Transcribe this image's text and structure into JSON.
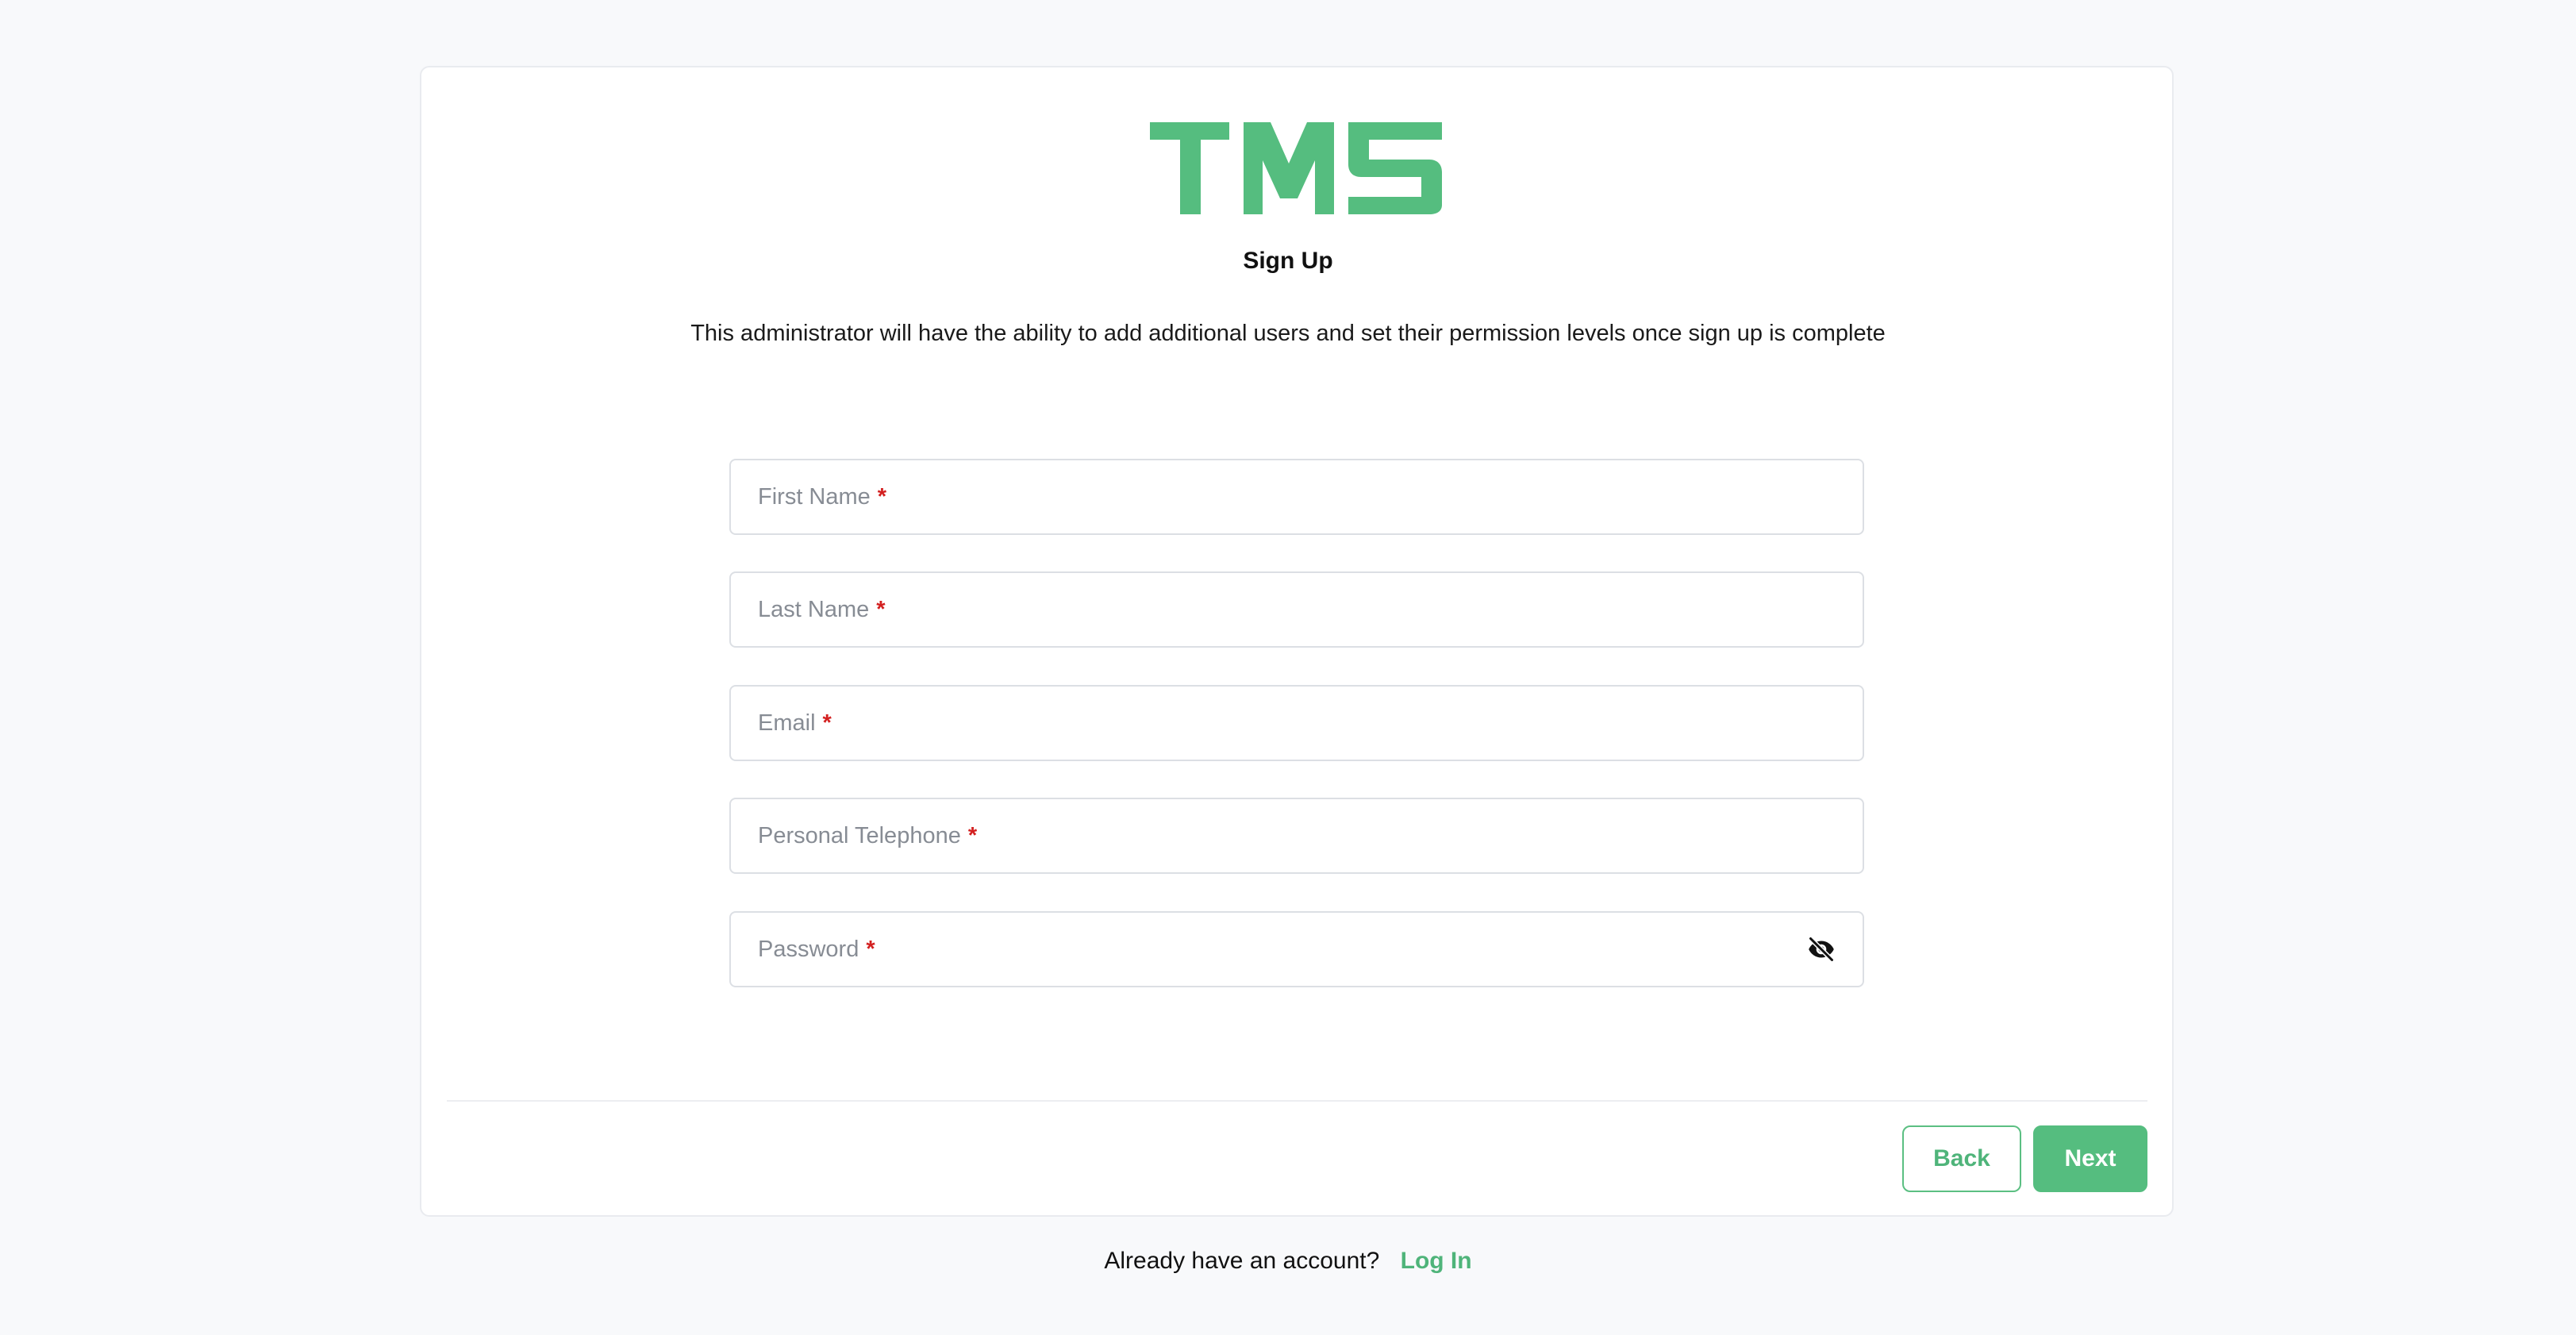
{
  "brand": {
    "logo_text": "TMS",
    "color": "#55bd7f"
  },
  "page": {
    "title": "Sign Up",
    "subtitle": "This administrator will have the ability to add additional users and set their permission levels once sign up is complete"
  },
  "form": {
    "required_marker": "*",
    "fields": [
      {
        "label": "First Name",
        "value": ""
      },
      {
        "label": "Last Name",
        "value": ""
      },
      {
        "label": "Email",
        "value": ""
      },
      {
        "label": "Personal Telephone",
        "value": ""
      },
      {
        "label": "Password",
        "value": "",
        "toggle_icon": "eye-slash-icon"
      }
    ]
  },
  "actions": {
    "back_label": "Back",
    "next_label": "Next"
  },
  "footer": {
    "prompt": "Already have an account?",
    "login_label": "Log In"
  },
  "colors": {
    "accent": "#55bd7f",
    "required": "#d32020",
    "placeholder": "#878c94",
    "background": "#f8f9fb"
  }
}
